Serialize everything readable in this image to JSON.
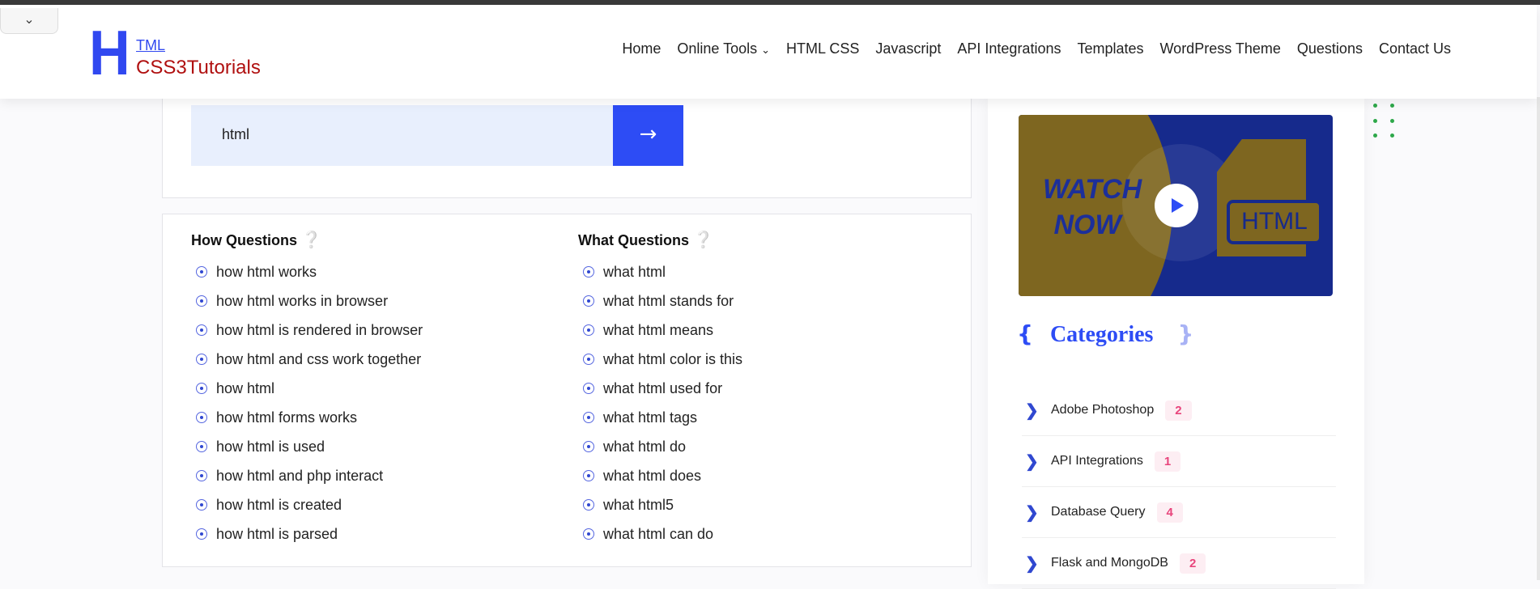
{
  "header": {
    "logo": {
      "big": "H",
      "top": "TML",
      "bottom": "CSS3Tutorials"
    },
    "nav": [
      "Home",
      "Online Tools",
      "HTML CSS",
      "Javascript",
      "API Integrations",
      "Templates",
      "WordPress Theme",
      "Questions",
      "Contact Us"
    ]
  },
  "search": {
    "value": "html",
    "button_icon": "arrow-right-icon"
  },
  "how": {
    "title": "How Questions",
    "items": [
      "how html works",
      "how html works in browser",
      "how html is rendered in browser",
      "how html and css work together",
      "how html",
      "how html forms works",
      "how html is used",
      "how html and php interact",
      "how html is created",
      "how html is parsed"
    ]
  },
  "what": {
    "title": "What Questions",
    "items": [
      "what html",
      "what html stands for",
      "what html means",
      "what html color is this",
      "what html used for",
      "what html tags",
      "what html do",
      "what html does",
      "what html5",
      "what html can do"
    ]
  },
  "video": {
    "text1": "WATCH",
    "text2": "NOW",
    "doc_label": "HTML"
  },
  "categories": {
    "title": "Categories",
    "open": "{",
    "close": "}",
    "items": [
      {
        "name": "Adobe Photoshop",
        "count": "2"
      },
      {
        "name": "API Integrations",
        "count": "1"
      },
      {
        "name": "Database Query",
        "count": "4"
      },
      {
        "name": "Flask and MongoDB",
        "count": "2"
      }
    ]
  },
  "colors": {
    "accent": "#2d4cf5",
    "logo_red": "#b01010",
    "badge": "#e8457c"
  }
}
